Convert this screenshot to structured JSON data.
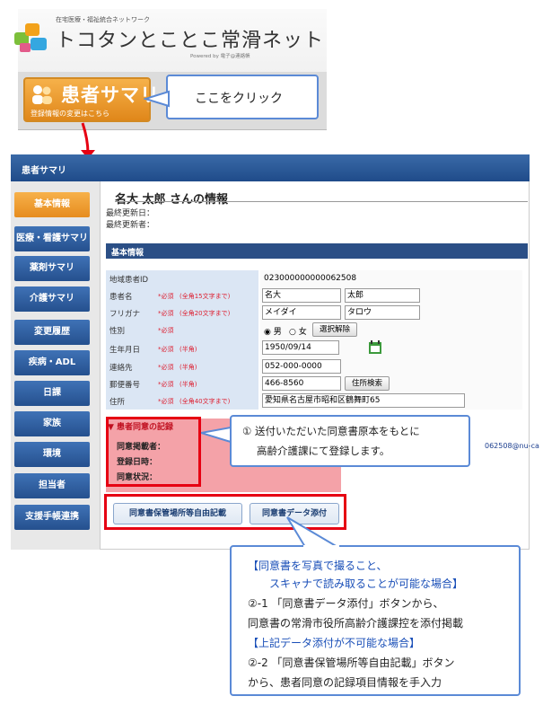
{
  "header": {
    "brand_small": "在宅医療・福祉統合ネットワーク",
    "brand_title": "トコタンとことこ常滑ネット",
    "brand_powered": "Powered by 電子@連絡帳",
    "patient_button_title": "患者サマリ",
    "patient_button_sub": "登録情報の変更はこちら",
    "callout_click": "ここをクリック"
  },
  "window": {
    "title": "患者サマリ"
  },
  "sidebar": {
    "items": [
      "基本情報",
      "医療・看護サマリ",
      "薬剤サマリ",
      "介護サマリ",
      "変更履歴",
      "疾病・ADL",
      "日課",
      "家族",
      "環境",
      "担当者",
      "支援手帳連携"
    ],
    "active_index": 0
  },
  "patient": {
    "heading": "名大 太郎 さんの情報",
    "updated_date_label": "最終更新日：",
    "updated_by_label": "最終更新者："
  },
  "section_title": "基本情報",
  "form": {
    "region_id_label": "地域患者ID",
    "region_id_value": "023000000000062508",
    "name_label": "患者名",
    "name_req": "*必須",
    "name_note": "(全角15文字まで)",
    "name_last": "名大",
    "name_first": "太郎",
    "kana_label": "フリガナ",
    "kana_req": "*必須",
    "kana_note": "(全角20文字まで)",
    "kana_last": "メイダイ",
    "kana_first": "タロウ",
    "sex_label": "性別",
    "sex_req": "*必須",
    "sex_male": "◉ 男",
    "sex_female": "○ 女",
    "sex_clear": "選択解除",
    "dob_label": "生年月日",
    "dob_req": "*必須",
    "dob_note": "(半角)",
    "dob_value": "1950/09/14",
    "tel_label": "連絡先",
    "tel_req": "*必須",
    "tel_note": "(半角)",
    "tel_value": "052-000-0000",
    "zip_label": "郵便番号",
    "zip_req": "*必須",
    "zip_note": "(半角)",
    "zip_value": "466-8560",
    "zip_search": "住所検索",
    "addr_label": "住所",
    "addr_req": "*必須",
    "addr_note": "(全角40文字まで)",
    "addr_value": "愛知県名古屋市昭和区鶴舞町65"
  },
  "consent": {
    "header": "▼ 患者同意の記録",
    "taker": "同意掲載者：",
    "datetime": "登録日時：",
    "status": "同意状況：",
    "btn_free": "同意書保管場所等自由記載",
    "btn_attach": "同意書データ添付",
    "email_partial": "062508@nu-ca"
  },
  "callout2": {
    "line1": "① 送付いただいた同意書原本をもとに",
    "line2": "高齢介護課にて登録します。"
  },
  "callout3": {
    "line1": "【同意書を写真で撮ること、",
    "line2": "スキャナで読み取ることが可能な場合】",
    "line3": "②-1 「同意書データ添付」ボタンから、",
    "line4": "同意書の常滑市役所高齢介護課控を添付掲載",
    "line5": "【上記データ添付が不可能な場合】",
    "line6": "②-2 「同意書保管場所等自由記載」ボタン",
    "line7": "から、患者同意の記録項目情報を手入力"
  },
  "colors": {
    "accent_orange": "#e68c1f",
    "nav_blue": "#2b4f86",
    "highlight_red": "#e60012",
    "callout_blue": "#5b8ad6"
  }
}
